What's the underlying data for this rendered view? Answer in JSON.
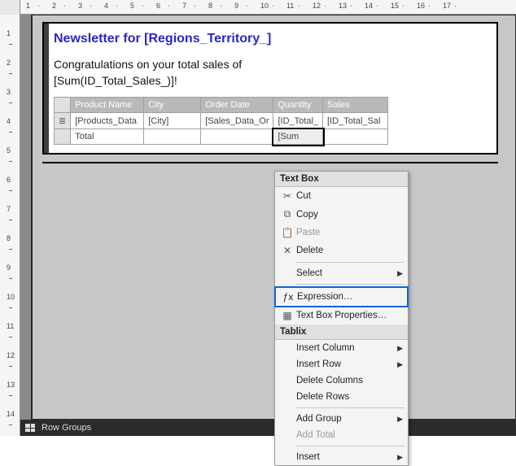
{
  "ruler": {
    "h_marks": [
      1,
      2,
      3,
      4,
      5,
      6,
      7,
      8,
      9,
      10,
      11,
      12,
      13,
      14,
      15,
      16,
      17
    ],
    "v_marks": [
      1,
      2,
      3,
      4,
      5,
      6,
      7,
      8,
      9,
      10,
      11,
      12,
      13,
      14
    ]
  },
  "report": {
    "title": "Newsletter for [Regions_Territory_]",
    "subtitle_line1": "Congratulations on your total sales of",
    "subtitle_line2": "[Sum(ID_Total_Sales_)]!"
  },
  "tablix": {
    "headers": [
      "Product Name",
      "City",
      "Order Date",
      "Quantity",
      "Sales"
    ],
    "detail": [
      "[Products_Data",
      "[City]",
      "[Sales_Data_Or",
      "[ID_Total_",
      "[ID_Total_Sal"
    ],
    "footer_label": "Total",
    "footer_sum": "[Sum"
  },
  "footer": {
    "label": "Row Groups"
  },
  "context_menu": {
    "header1": "Text Box",
    "cut": "Cut",
    "copy": "Copy",
    "paste": "Paste",
    "delete": "Delete",
    "select": "Select",
    "expression": "Expression…",
    "textbox_props": "Text Box Properties…",
    "header2": "Tablix",
    "insert_column": "Insert Column",
    "insert_row": "Insert Row",
    "delete_columns": "Delete Columns",
    "delete_rows": "Delete Rows",
    "add_group": "Add Group",
    "add_total": "Add Total",
    "insert": "Insert"
  },
  "icons": {
    "cut": "✂",
    "copy": "⧉",
    "paste": "📋",
    "delete": "✕",
    "fx": "ƒx",
    "props": "▦"
  }
}
